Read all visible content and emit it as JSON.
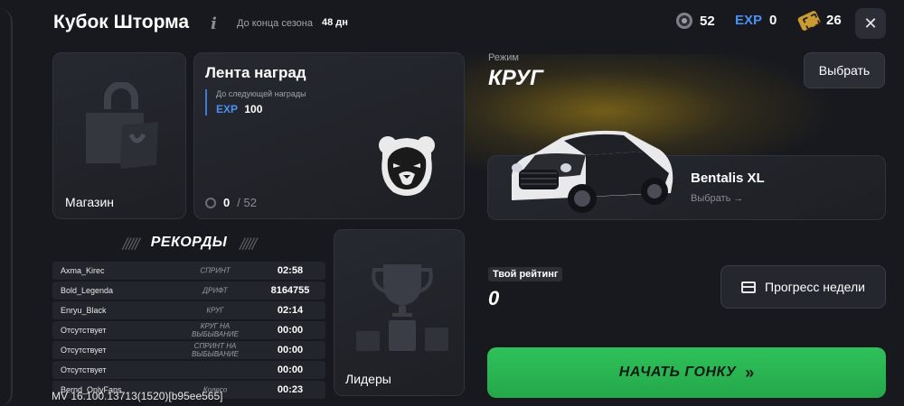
{
  "header": {
    "title": "Кубок Шторма",
    "info_icon": "i",
    "season_label": "До конца сезона",
    "season_value": "48 дн",
    "wheels": "52",
    "exp_label": "EXP",
    "exp_value": "0",
    "tickets": "26",
    "close_icon": "✕"
  },
  "shop": {
    "label": "Магазин",
    "icon": "shopping-bag-icon"
  },
  "rewards": {
    "title": "Лента наград",
    "next_label": "До следующей награды",
    "next_exp_label": "EXP",
    "next_exp_value": "100",
    "progress_current": "0",
    "progress_total": "/ 52"
  },
  "records": {
    "title": "РЕКОРДЫ",
    "stripes": "/////",
    "rows": [
      {
        "name": "Axma_Kirec",
        "mode": "СПРИНТ",
        "value": "02:58"
      },
      {
        "name": "Bold_Legenda",
        "mode": "ДРИФТ",
        "value": "8164755"
      },
      {
        "name": "Enryu_Black",
        "mode": "КРУГ",
        "value": "02:14"
      },
      {
        "name": "Отсутствует",
        "mode": "КРУГ НА ВЫБЫВАНИЕ",
        "value": "00:00"
      },
      {
        "name": "Отсутствует",
        "mode": "СПРИНТ НА ВЫБЫВАНИЕ",
        "value": "00:00"
      },
      {
        "name": "Отсутствует",
        "mode": "",
        "value": "00:00"
      },
      {
        "name": "Bernd_OnlyFans",
        "mode": "Колесо",
        "value": "00:23"
      }
    ]
  },
  "leaders": {
    "label": "Лидеры",
    "icon": "trophy-icon"
  },
  "mode": {
    "label": "Режим",
    "value": "КРУГ",
    "choose_label": "Выбрать"
  },
  "car": {
    "name": "Bentalis XL",
    "choose_label": "Выбрать →"
  },
  "rating": {
    "label": "Твой рейтинг",
    "value": "0"
  },
  "week_progress": {
    "label": "Прогресс недели"
  },
  "start": {
    "label": "НАЧАТЬ ГОНКУ",
    "arrow": "»"
  },
  "version": "MV 16.100.13713(1520)[b95ee565]",
  "colors": {
    "accent_exp": "#4b8ff0",
    "start_green": "#2fc15a",
    "background": "#17191e"
  }
}
